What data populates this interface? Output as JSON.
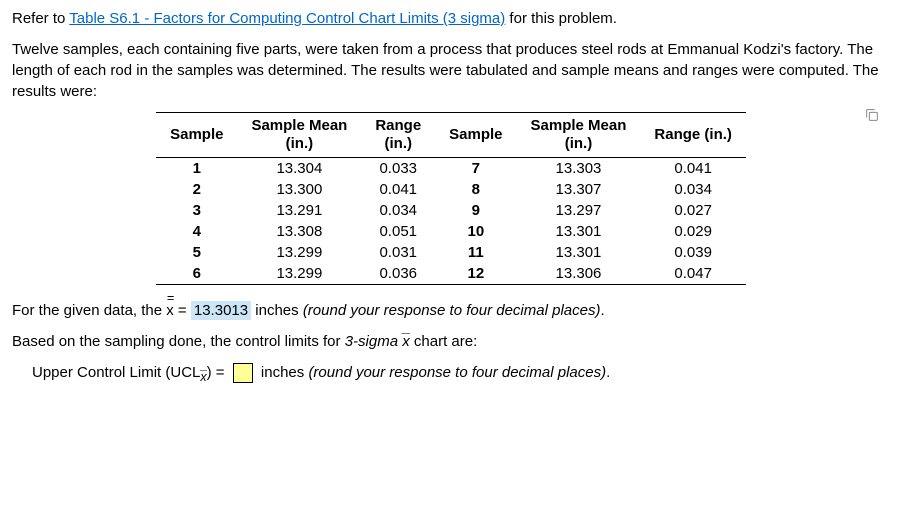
{
  "intro": {
    "refer_prefix": "Refer to ",
    "link_text": "Table S6.1 - Factors for Computing Control Chart Limits (3 sigma)",
    "refer_suffix": " for this problem."
  },
  "description": "Twelve samples, each containing five parts, were taken from a process that produces steel rods at Emmanual Kodzi's factory. The length of each rod in the samples was determined. The results were tabulated and sample means and ranges were computed. The results were:",
  "table": {
    "headers": {
      "sample": "Sample",
      "mean": "Sample Mean\n(in.)",
      "range": "Range\n(in.)",
      "sample2": "Sample",
      "mean2": "Sample Mean\n(in.)",
      "range2": "Range (in.)"
    },
    "left": [
      {
        "sample": "1",
        "mean": "13.304",
        "range": "0.033"
      },
      {
        "sample": "2",
        "mean": "13.300",
        "range": "0.041"
      },
      {
        "sample": "3",
        "mean": "13.291",
        "range": "0.034"
      },
      {
        "sample": "4",
        "mean": "13.308",
        "range": "0.051"
      },
      {
        "sample": "5",
        "mean": "13.299",
        "range": "0.031"
      },
      {
        "sample": "6",
        "mean": "13.299",
        "range": "0.036"
      }
    ],
    "right": [
      {
        "sample": "7",
        "mean": "13.303",
        "range": "0.041"
      },
      {
        "sample": "8",
        "mean": "13.307",
        "range": "0.034"
      },
      {
        "sample": "9",
        "mean": "13.297",
        "range": "0.027"
      },
      {
        "sample": "10",
        "mean": "13.301",
        "range": "0.029"
      },
      {
        "sample": "11",
        "mean": "13.301",
        "range": "0.039"
      },
      {
        "sample": "12",
        "mean": "13.306",
        "range": "0.047"
      }
    ]
  },
  "answer1": {
    "prefix": "For the given data, the ",
    "xvar": "x",
    "equals": " = ",
    "value": "13.3013",
    "units": " inches ",
    "hint": "(round your response to four decimal places)",
    "period": "."
  },
  "control_text": {
    "prefix": "Based on the sampling done, the control limits for ",
    "italic_part": "3-sigma ",
    "xvar": "x",
    "suffix": " chart are:"
  },
  "ucl": {
    "prefix": "Upper Control Limit (UCL",
    "sub": "x̄",
    "closeparen": ") = ",
    "units": " inches ",
    "hint": "(round your response to four decimal places)",
    "period": "."
  }
}
